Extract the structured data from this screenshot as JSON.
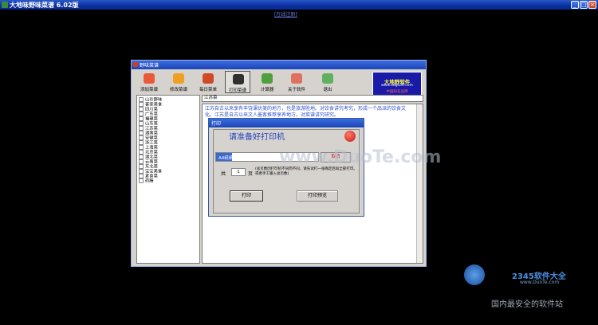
{
  "outer": {
    "title": "大地味野味菜谱  6.02版",
    "link": "[在线注册]",
    "min_glyph": "_",
    "max_glyph": "□",
    "close_glyph": "×"
  },
  "window": {
    "title": "野味菜谱",
    "toolbar": [
      {
        "label": "添加菜谱",
        "color": "#e85a3a"
      },
      {
        "label": "修改菜谱",
        "color": "#f0a020"
      },
      {
        "label": "每日菜单",
        "color": "#d04a2a"
      },
      {
        "label": "打印菜谱",
        "color": "#303030"
      },
      {
        "label": "计算器",
        "color": "#50a040"
      },
      {
        "label": "关于软件",
        "color": "#e07060"
      },
      {
        "label": "退出",
        "color": "#60b060"
      }
    ],
    "logo": {
      "line1": "大地野软件",
      "line2": "www.ddgsoft.com",
      "line3": "中国知名品牌"
    },
    "tree_items": [
      "山珍野味",
      "客家美食",
      "四川菜",
      "广东菜",
      "福建菜",
      "山东菜",
      "江苏菜",
      "湖南菜",
      "安徽菜",
      "浙江菜",
      "上海菜",
      "北京菜",
      "湖北菜",
      "云南菜",
      "东北菜",
      "宝宝美食",
      "素食菜",
      "药膳"
    ],
    "category_field": "江苏菜",
    "content_text": "江苏自古以来享有丰饶课优美的地方，也是旅游胜地。对饮食讲究考究，形成一个品派的饮食文化。江苏是自古以来文人墨客推荐享养地方。对菜谱讲究研究。"
  },
  "dialog": {
    "title": "打印",
    "heading": "请准备好打印机",
    "progress_label": "A4纸纸幅",
    "progress_fraction": 0.16,
    "cancel": "取消",
    "count_prefix": "共",
    "count_value": "1",
    "count_suffix": "页",
    "note": "(总页数因打印机不同而不同，请先试打一张确定后再全部打印。或者手工输入总页数)",
    "print_button": "打印",
    "preview_button": "打印预览"
  },
  "watermarks": {
    "center": "www.DuoTe.com",
    "badge_name": "2345软件大全",
    "badge_url": "www.DuoTe.com",
    "slogan": "国内最安全的软件站"
  }
}
